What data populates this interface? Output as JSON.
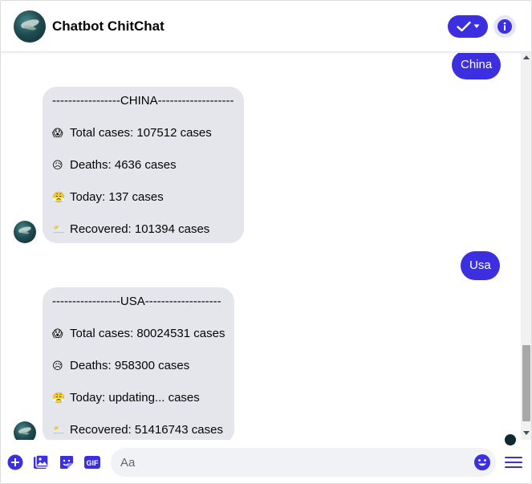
{
  "header": {
    "title": "Chatbot ChitChat",
    "avatar_icon": "user-avatar",
    "status_icon": "check-dropdown-icon",
    "info_icon": "info-icon"
  },
  "messages": [
    {
      "type": "outgoing",
      "text": "China"
    },
    {
      "type": "incoming",
      "lines": [
        {
          "emoji": "😱",
          "text": "-----------------CHINA-------------------"
        },
        {
          "emoji": "😱",
          "text": "Total cases: 107512 cases"
        },
        {
          "emoji": "😥",
          "text": "Deaths: 4636 cases"
        },
        {
          "emoji": "😤",
          "text": "Today: 137 cases"
        },
        {
          "emoji": "🌥️",
          "text": "Recovered: 101394 cases"
        }
      ]
    },
    {
      "type": "outgoing",
      "text": "Usa"
    },
    {
      "type": "incoming",
      "lines": [
        {
          "emoji": "",
          "text": "-----------------USA-------------------"
        },
        {
          "emoji": "😱",
          "text": "Total cases: 80024531 cases"
        },
        {
          "emoji": "😥",
          "text": "Deaths: 958300 cases"
        },
        {
          "emoji": "😤",
          "text": "Today: updating... cases"
        },
        {
          "emoji": "🌥️",
          "text": "Recovered: 51416743 cases"
        }
      ]
    }
  ],
  "composer": {
    "placeholder": "Aa",
    "add_icon": "plus-circle-icon",
    "image_icon": "image-icon",
    "sticker_icon": "sticker-icon",
    "gif_label": "GIF",
    "emoji_icon": "emoji-icon",
    "menu_icon": "hamburger-menu-icon"
  },
  "colors": {
    "accent": "#3b2fe0",
    "bubble_in": "#e4e6eb",
    "input_bg": "#f0f2f5"
  }
}
